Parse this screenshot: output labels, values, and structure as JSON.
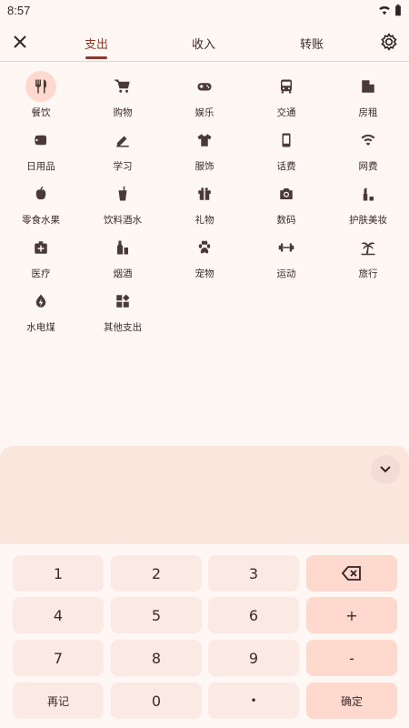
{
  "status_bar": {
    "time": "8:57",
    "icons": [
      "wifi-icon",
      "battery-icon"
    ]
  },
  "header": {
    "tabs": [
      {
        "label": "支出",
        "active": true
      },
      {
        "label": "收入",
        "active": false
      },
      {
        "label": "转账",
        "active": false
      }
    ],
    "close_icon": "close-icon",
    "settings_icon": "gear-icon"
  },
  "categories": [
    {
      "label": "餐饮",
      "icon": "fork-knife-icon",
      "selected": true
    },
    {
      "label": "购物",
      "icon": "shopping-cart-icon"
    },
    {
      "label": "娱乐",
      "icon": "gamepad-icon"
    },
    {
      "label": "交通",
      "icon": "bus-icon"
    },
    {
      "label": "房租",
      "icon": "building-icon"
    },
    {
      "label": "日用品",
      "icon": "toilet-paper-icon"
    },
    {
      "label": "学习",
      "icon": "pen-icon"
    },
    {
      "label": "服饰",
      "icon": "tshirt-icon"
    },
    {
      "label": "话费",
      "icon": "phone-icon"
    },
    {
      "label": "网费",
      "icon": "wifi-icon"
    },
    {
      "label": "零食水果",
      "icon": "apple-icon"
    },
    {
      "label": "饮料酒水",
      "icon": "cup-icon"
    },
    {
      "label": "礼物",
      "icon": "gift-icon"
    },
    {
      "label": "数码",
      "icon": "camera-icon"
    },
    {
      "label": "护肤美妆",
      "icon": "lipstick-icon"
    },
    {
      "label": "医疗",
      "icon": "medkit-icon"
    },
    {
      "label": "烟酒",
      "icon": "bottle-icon"
    },
    {
      "label": "宠物",
      "icon": "paw-icon"
    },
    {
      "label": "运动",
      "icon": "dumbbell-icon"
    },
    {
      "label": "旅行",
      "icon": "palm-tree-icon"
    },
    {
      "label": "水电煤",
      "icon": "energy-icon"
    },
    {
      "label": "其他支出",
      "icon": "widgets-icon"
    }
  ],
  "panel": {
    "collapse_icon": "chevron-down-icon"
  },
  "keypad": {
    "keys": [
      "1",
      "2",
      "3",
      "4",
      "5",
      "6",
      "7",
      "8",
      "9",
      "再记",
      "0",
      "•"
    ],
    "backspace_icon": "backspace-icon",
    "plus": "+",
    "minus": "-",
    "confirm": "确定"
  },
  "colors": {
    "accent": "#8a3b2b",
    "selected_bg": "#ffd9cf",
    "key_bg": "#fbe9e4",
    "key_accent": "#ffd8ce"
  }
}
